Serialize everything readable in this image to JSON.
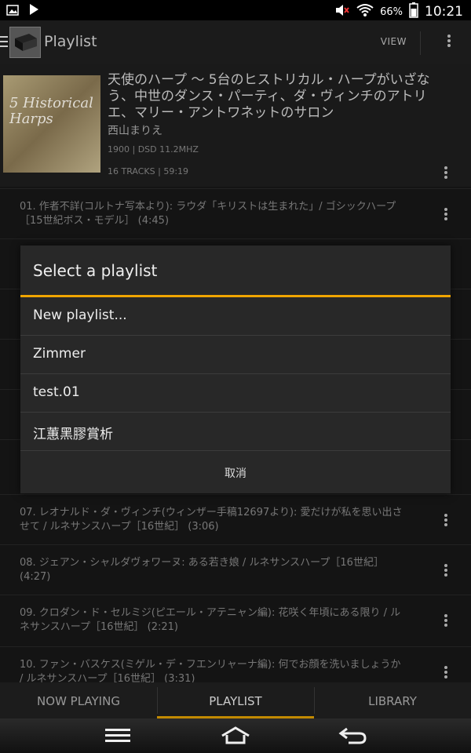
{
  "status_bar": {
    "battery": "66%",
    "time": "10:21",
    "icons": [
      "gallery-icon",
      "play-icon",
      "mute-icon",
      "wifi-icon",
      "battery-icon"
    ]
  },
  "app_bar": {
    "title": "Playlist",
    "view_label": "VIEW"
  },
  "album": {
    "title": "天使のハープ ～ 5台のヒストリカル・ハープがいざなう、中世のダンス・パーティ、ダ・ヴィンチのアトリエ、マリー・アントワネットのサロン",
    "artist": "西山まりえ",
    "format": "1900 | DSD 11.2MHZ",
    "tracks_info": "16 TRACKS | 59:19",
    "cover_text": "5 Historical Harps"
  },
  "tracks": [
    {
      "title": "01. 作者不詳(コルトナ写本より): ラウダ「キリストは生まれた」/ ゴシックハープ［15世紀ボス・モデル］ (4:45)"
    },
    {
      "title": "07. レオナルド・ダ・ヴィンチ(ウィンザー手稿12697より): 愛だけが私を思い出させて / ルネサンスハープ［16世紀］ (3:06)"
    },
    {
      "title": "08. ジェアン・シャルダヴォワーヌ: ある若き娘 / ルネサンスハープ［16世紀］ (4:27)"
    },
    {
      "title": "09. クロダン・ド・セルミジ(ピエール・アテニャン編): 花咲く年頃にある限り / ルネサンスハープ［16世紀］ (2:21)"
    },
    {
      "title": "10. ファン・バスケス(ミゲル・デ・フエンリャーナ編): 何でお顔を洗いましょうか / ルネサンスハープ［16世紀］ (3:31)"
    }
  ],
  "dialog": {
    "title": "Select a playlist",
    "options": [
      "New playlist...",
      "Zimmer",
      "test.01",
      "江蕙黑膠賞析"
    ],
    "cancel_label": "取消"
  },
  "bottom_tabs": [
    "NOW PLAYING",
    "PLAYLIST",
    "LIBRARY"
  ],
  "active_tab": "PLAYLIST",
  "colors": {
    "accent": "#f0a500",
    "tab_underline": "#c28a00",
    "dialog_bg": "#282828"
  }
}
